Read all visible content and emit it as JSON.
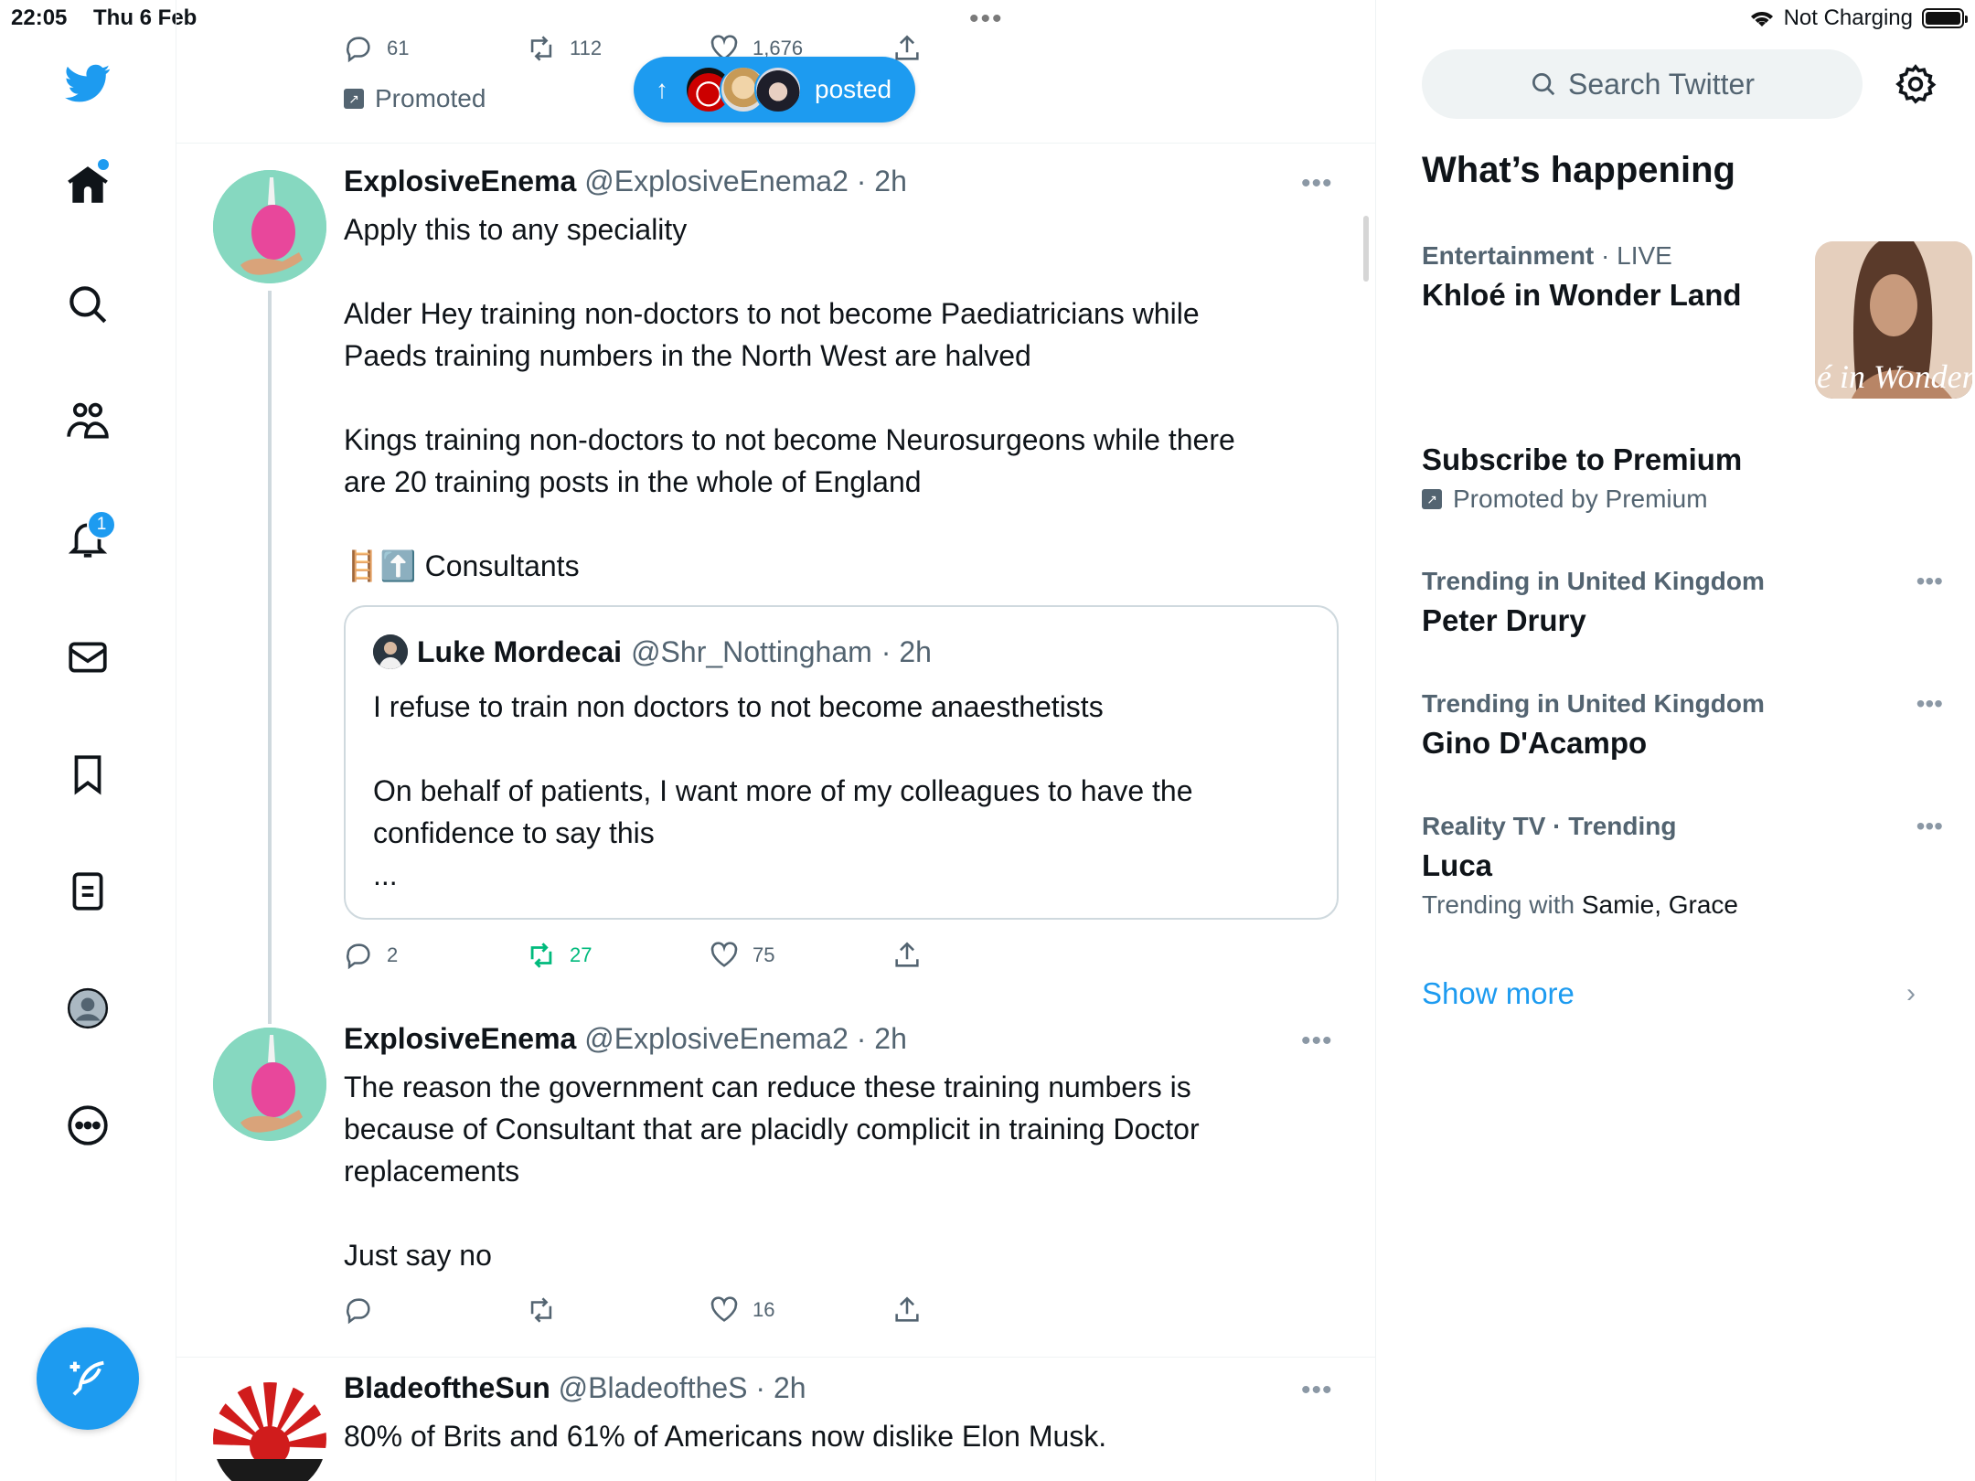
{
  "status_bar": {
    "time": "22:05",
    "date": "Thu 6 Feb",
    "battery_text": "Not Charging"
  },
  "nav": {
    "notifications_badge": "1"
  },
  "top_tweet": {
    "replies": "61",
    "retweets": "112",
    "likes": "1,676",
    "promoted_label": "Promoted"
  },
  "new_posts_pill": {
    "label": "posted"
  },
  "tweets": [
    {
      "name": "ExplosiveEnema",
      "handle": "@ExplosiveEnema2",
      "time": "· 2h",
      "text": "Apply this to any speciality\n\nAlder Hey training non-doctors to not become Paediatricians while Paeds training numbers in the North West are halved\n\nKings training non-doctors to not become Neurosurgeons while there are 20 training posts in the whole of England\n\n🪜⬆️ Consultants",
      "quote": {
        "name": "Luke Mordecai",
        "handle": "@Shr_Nottingham",
        "time": "· 2h",
        "text": "I refuse to train non doctors to not become anaesthetists\n\nOn behalf of patients, I want more of my colleagues to have the confidence to say this\n..."
      },
      "replies": "2",
      "retweets": "27",
      "likes": "75"
    },
    {
      "name": "ExplosiveEnema",
      "handle": "@ExplosiveEnema2",
      "time": "· 2h",
      "text": "The reason the government can reduce these training numbers is because of Consultant that are placidly complicit in training Doctor replacements\n\nJust say no",
      "replies": "",
      "retweets": "",
      "likes": "16"
    },
    {
      "name": "BladeoftheSun",
      "handle": "@BladeoftheS",
      "time": "· 2h",
      "text": "80% of Brits and 61% of Americans now dislike Elon Musk."
    }
  ],
  "sidebar": {
    "search_placeholder": "Search Twitter",
    "section_title": "What’s happening",
    "trends": [
      {
        "context": "Entertainment",
        "context_extra": "· LIVE",
        "title": "Khloé in Wonder Land",
        "image_text": "é in Wonder L"
      },
      {
        "context": "",
        "title": "Subscribe to Premium",
        "promoted": "Promoted by Premium"
      },
      {
        "context": "Trending in United Kingdom",
        "title": "Peter Drury"
      },
      {
        "context": "Trending in United Kingdom",
        "title": "Gino D'Acampo"
      },
      {
        "context": "Reality TV · Trending",
        "title": "Luca",
        "sub_prefix": "Trending with",
        "sub_names": "Samie, Grace"
      }
    ],
    "show_more": "Show more"
  },
  "colors": {
    "accent": "#1d9bf0",
    "retweet_green": "#00ba7c",
    "secondary_text": "#536471"
  }
}
